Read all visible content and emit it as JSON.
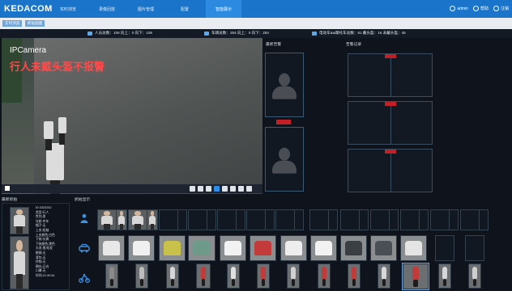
{
  "app": {
    "logo": "KEDACOM",
    "nav": [
      "实时浏览",
      "录像回放",
      "图片管理",
      "配置",
      "智能展示"
    ],
    "nav_active": 4,
    "user": "admin",
    "help": "帮助",
    "logout": "注销"
  },
  "subtabs": [
    "实时浏览",
    "抓拍画面"
  ],
  "stats": {
    "people": "人员总数：106  向上：0  向下：106",
    "vehicles": "车辆总数：284  向上：0  向下：284",
    "nonmotor": "电动车&&摩托车总数：61  戴头盔：16  未戴头盔：45"
  },
  "video": {
    "camera_label": "IPCamera",
    "alert_text": "行人未戴头盔不报警"
  },
  "panels": {
    "latest_alarm": "最新告警",
    "alarm_records": "告警记录",
    "latest_capture": "最新抓拍",
    "capture_display": "抓拍显示"
  },
  "latest_info": [
    "ID:3320252",
    "类型:行人",
    "性别:男",
    "年龄:中年",
    "帽子:无",
    "上衣:短袖",
    "上衣颜色:白色",
    "下装:长裤",
    "下装颜色:黑色",
    "头发:黑/短发",
    "眼镜:无",
    "背包:无",
    "拎物:无",
    "朝向:正向",
    "口罩:无",
    "时间:22:39:54"
  ],
  "icons": {
    "person": "person-icon",
    "car": "car-icon",
    "bike": "motorbike-icon"
  },
  "colors": {
    "topbar": "#1a74c9",
    "alert_red": "#c21f26",
    "accent": "#2f8ee8"
  }
}
